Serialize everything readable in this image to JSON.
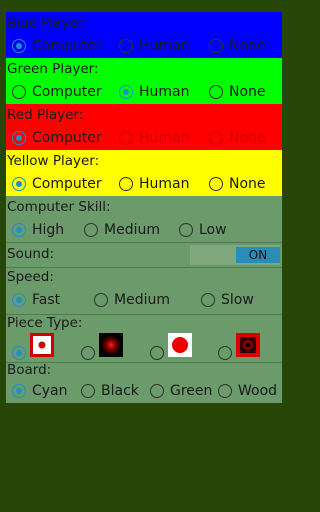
{
  "colors": {
    "background": "#274708",
    "panel": "#6b9a6b",
    "blue": "#0000ff",
    "green": "#00ff00",
    "red": "#ff0000",
    "yellow": "#ffff00",
    "accent": "#1e90c8"
  },
  "players": [
    {
      "label": "Blue Player:",
      "options": [
        "Computer",
        "Human",
        "None"
      ],
      "selected": "Computer"
    },
    {
      "label": "Green Player:",
      "options": [
        "Computer",
        "Human",
        "None"
      ],
      "selected": "Human"
    },
    {
      "label": "Red Player:",
      "options": [
        "Computer",
        "Human",
        "None"
      ],
      "selected": "Computer"
    },
    {
      "label": "Yellow Player:",
      "options": [
        "Computer",
        "Human",
        "None"
      ],
      "selected": "Computer"
    }
  ],
  "skill": {
    "label": "Computer Skill:",
    "options": [
      "High",
      "Medium",
      "Low"
    ],
    "selected": "High"
  },
  "sound": {
    "label": "Sound:",
    "toggle": "ON"
  },
  "speed": {
    "label": "Speed:",
    "options": [
      "Fast",
      "Medium",
      "Slow"
    ],
    "selected": "Fast"
  },
  "piece": {
    "label": "Piece Type:",
    "options": [
      "white-square-red-dot",
      "black-square-red-glow",
      "white-square-red-circle",
      "red-square-black-target"
    ],
    "selected": "white-square-red-dot"
  },
  "board": {
    "label": "Board:",
    "options": [
      "Cyan",
      "Black",
      "Green",
      "Wood"
    ],
    "selected": "Cyan"
  }
}
